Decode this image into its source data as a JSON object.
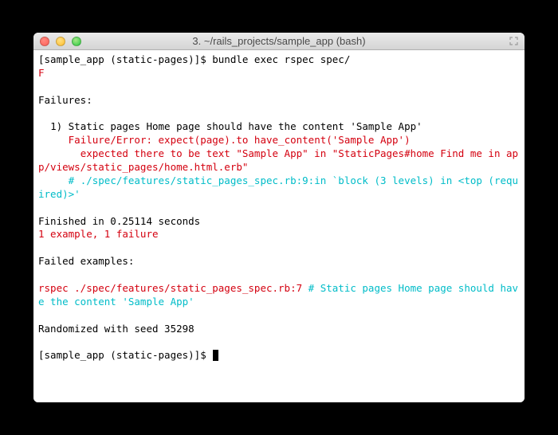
{
  "window": {
    "title": "3. ~/rails_projects/sample_app (bash)"
  },
  "term": {
    "prompt1": "[sample_app (static-pages)]$ ",
    "cmd1": "bundle exec rspec spec/",
    "f": "F",
    "blank": "",
    "failures_hdr": "Failures:",
    "fail1": "  1) Static pages Home page should have the content 'Sample App'",
    "fail_err": "     Failure/Error: expect(page).to have_content('Sample App')",
    "fail_expected": "       expected there to be text \"Sample App\" in \"StaticPages#home Find me in app/views/static_pages/home.html.erb\"",
    "trace": "     # ./spec/features/static_pages_spec.rb:9:in `block (3 levels) in <top (required)>'",
    "finished": "Finished in 0.25114 seconds",
    "summary": "1 example, 1 failure",
    "failed_hdr": "Failed examples:",
    "rspec_line": "rspec ./spec/features/static_pages_spec.rb:7",
    "rspec_comment": " # Static pages Home page should have the content 'Sample App'",
    "randomized": "Randomized with seed 35298",
    "prompt2": "[sample_app (static-pages)]$ "
  }
}
